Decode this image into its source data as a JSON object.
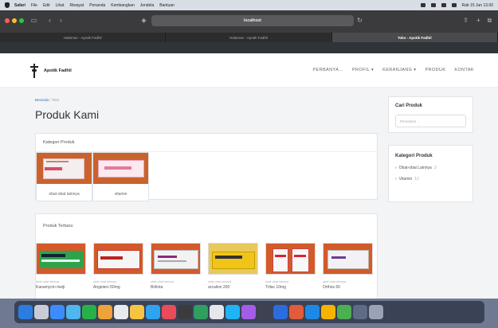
{
  "menubar": {
    "items": [
      "Safari",
      "File",
      "Edit",
      "Lihat",
      "Riwayat",
      "Penanda",
      "Kembangkan",
      "Jendela",
      "Bantuan"
    ],
    "datetime": "Rab 15 Jun 13.00"
  },
  "browser": {
    "url": "localhost",
    "tabs": [
      "Halaman - Apotik Fadhil",
      "Halaman - Apotik Fadhil",
      "Toko - Apotik Fadhil"
    ]
  },
  "site": {
    "logo_text": "Apotik Fadhil",
    "nav": [
      "PERBANYA...",
      "PROFIL ▾",
      "KERANJANG ▾",
      "PRODUK",
      "KONTAK"
    ]
  },
  "breadcrumb": {
    "home": "Beranda",
    "separator": "/",
    "current": "Toko"
  },
  "page_title": "Produk Kami",
  "categories": {
    "heading": "Kategori Produk",
    "items": [
      {
        "label": "obat-obat lainnya"
      },
      {
        "label": "vitamin"
      }
    ]
  },
  "latest": {
    "heading": "Produk Terbaru",
    "products": [
      {
        "category": "obat-obat lainnya",
        "name": "Kanamycin meiji"
      },
      {
        "category": "obat-obat lainnya",
        "name": "Angioten 50mg"
      },
      {
        "category": "obat-obat lainnya",
        "name": "Brilinta"
      },
      {
        "category": "obat-obat lainnya",
        "name": "arcalion 200"
      },
      {
        "category": "obat-obat lainnya",
        "name": "Trilac 10mg"
      },
      {
        "category": "obat-obat lainnya",
        "name": "Orthos 60"
      }
    ]
  },
  "sidebar": {
    "search_title": "Cari Produk",
    "search_placeholder": "Pencarian ...",
    "categories_title": "Kategori Produk",
    "categories": [
      {
        "label": "Obat-obat Lainnya",
        "count": "3"
      },
      {
        "label": "Vitamin",
        "count": "12"
      }
    ]
  },
  "colors": {
    "accent": "#3a6fb0",
    "content_bg": "#f3f4f6"
  }
}
